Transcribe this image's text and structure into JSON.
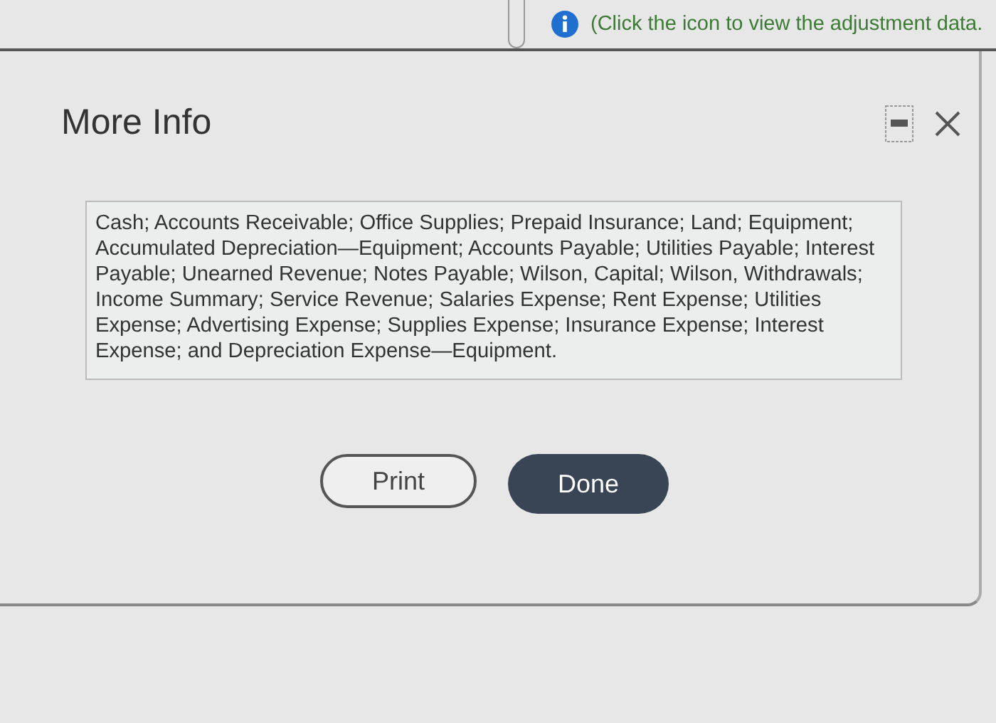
{
  "hint": {
    "text": "(Click the icon to view the adjustment data."
  },
  "dialog": {
    "title": "More Info",
    "body": "Cash; Accounts Receivable; Office Supplies; Prepaid Insurance; Land; Equipment; Accumulated Depreciation—Equipment; Accounts Payable; Utilities Payable; Interest Payable; Unearned Revenue; Notes Payable; Wilson, Capital; Wilson, Withdrawals; Income Summary; Service Revenue; Salaries Expense; Rent Expense; Utilities Expense; Advertising Expense; Supplies Expense; Insurance Expense; Interest Expense; and Depreciation Expense—Equipment.",
    "buttons": [
      {
        "label": "Print",
        "kind": "secondary"
      },
      {
        "label": "Done",
        "kind": "primary"
      }
    ]
  }
}
